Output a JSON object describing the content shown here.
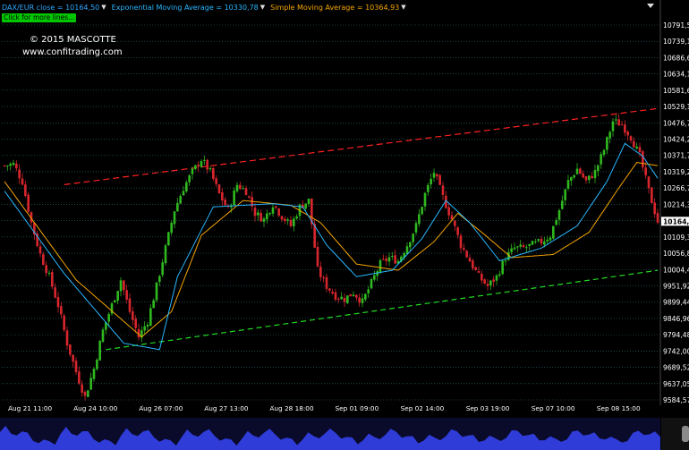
{
  "header": {
    "series": [
      {
        "label": "DAX/EUR close = 10164,50",
        "color": "#2fa8ff"
      },
      {
        "label": "Exponential Moving Average = 10330,78",
        "color": "#29b7ff"
      },
      {
        "label": "Simple Moving Average = 10364,93",
        "color": "#f5a500"
      }
    ],
    "more_lines": "Click for more lines...",
    "copyright": "© 2015 MASCOTTE",
    "website": "www.confitrading.com"
  },
  "colors": {
    "up": "#2fb81f",
    "down": "#d8262e",
    "ema": "#29b7ff",
    "sma": "#f5a500",
    "resistance": "#ff2222",
    "support": "#22dd22",
    "grid": "#2e6f7a",
    "volume": "#2f3cd8",
    "price_tag": "#ffffff"
  },
  "chart_data": {
    "type": "candlestick",
    "y_ticks": [
      "10791,58",
      "10739,10",
      "10686,62",
      "10634,14",
      "10581,66",
      "10529,18",
      "10476,71",
      "10424,23",
      "10371,75",
      "10319,27",
      "10266,79",
      "10214,31",
      "10161,83",
      "10109,35",
      "10056,88",
      "10004,40",
      "9951,92",
      "9899,44",
      "9846,96",
      "9794,48",
      "9742,00",
      "9689,52",
      "9637,05",
      "9584,57"
    ],
    "x_ticks": [
      "Aug 21 11:00",
      "Aug 24 10:00",
      "Aug 26 07:00",
      "Aug 27 13:00",
      "Aug 28 18:00",
      "Sep 01 09:00",
      "Sep 02 14:00",
      "Sep 03 19:00",
      "Sep 07 10:00",
      "Sep 08 15:00"
    ],
    "ylim": [
      9584.57,
      10791.58
    ],
    "last_price": "10164,50",
    "close_path": [
      [
        0,
        10340
      ],
      [
        3,
        10345
      ],
      [
        6,
        10290
      ],
      [
        9,
        10160
      ],
      [
        12,
        10060
      ],
      [
        15,
        9990
      ],
      [
        18,
        9900
      ],
      [
        21,
        9780
      ],
      [
        24,
        9690
      ],
      [
        27,
        9610
      ],
      [
        30,
        9700
      ],
      [
        33,
        9820
      ],
      [
        36,
        9900
      ],
      [
        39,
        9980
      ],
      [
        42,
        9880
      ],
      [
        45,
        9800
      ],
      [
        48,
        9850
      ],
      [
        51,
        9960
      ],
      [
        54,
        10080
      ],
      [
        57,
        10200
      ],
      [
        60,
        10270
      ],
      [
        63,
        10320
      ],
      [
        66,
        10360
      ],
      [
        69,
        10320
      ],
      [
        72,
        10250
      ],
      [
        75,
        10200
      ],
      [
        78,
        10280
      ],
      [
        81,
        10260
      ],
      [
        84,
        10190
      ],
      [
        87,
        10170
      ],
      [
        90,
        10220
      ],
      [
        93,
        10180
      ],
      [
        96,
        10150
      ],
      [
        99,
        10210
      ],
      [
        102,
        10230
      ],
      [
        105,
        10010
      ],
      [
        108,
        9960
      ],
      [
        111,
        9930
      ],
      [
        114,
        9920
      ],
      [
        117,
        9940
      ],
      [
        120,
        9910
      ],
      [
        123,
        9970
      ],
      [
        126,
        10030
      ],
      [
        129,
        10050
      ],
      [
        132,
        10040
      ],
      [
        135,
        10090
      ],
      [
        138,
        10150
      ],
      [
        141,
        10250
      ],
      [
        144,
        10320
      ],
      [
        147,
        10240
      ],
      [
        150,
        10170
      ],
      [
        153,
        10090
      ],
      [
        156,
        10040
      ],
      [
        159,
        9990
      ],
      [
        162,
        9960
      ],
      [
        165,
        9990
      ],
      [
        168,
        10050
      ],
      [
        171,
        10080
      ],
      [
        174,
        10080
      ],
      [
        177,
        10090
      ],
      [
        180,
        10100
      ],
      [
        183,
        10120
      ],
      [
        186,
        10200
      ],
      [
        189,
        10290
      ],
      [
        192,
        10330
      ],
      [
        195,
        10290
      ],
      [
        198,
        10320
      ],
      [
        201,
        10390
      ],
      [
        204,
        10480
      ],
      [
        207,
        10470
      ],
      [
        210,
        10430
      ],
      [
        213,
        10370
      ],
      [
        216,
        10260
      ],
      [
        219,
        10164
      ]
    ],
    "ema_path": [
      [
        0,
        10260
      ],
      [
        20,
        10000
      ],
      [
        40,
        9780
      ],
      [
        52,
        9760
      ],
      [
        58,
        9990
      ],
      [
        70,
        10210
      ],
      [
        90,
        10220
      ],
      [
        100,
        10210
      ],
      [
        108,
        10090
      ],
      [
        118,
        9990
      ],
      [
        130,
        10010
      ],
      [
        140,
        10110
      ],
      [
        148,
        10230
      ],
      [
        156,
        10160
      ],
      [
        166,
        10040
      ],
      [
        180,
        10080
      ],
      [
        192,
        10150
      ],
      [
        202,
        10290
      ],
      [
        208,
        10410
      ],
      [
        214,
        10370
      ],
      [
        219,
        10300
      ]
    ],
    "sma_path": [
      [
        0,
        10290
      ],
      [
        24,
        9980
      ],
      [
        46,
        9800
      ],
      [
        56,
        9880
      ],
      [
        66,
        10120
      ],
      [
        80,
        10230
      ],
      [
        96,
        10215
      ],
      [
        106,
        10160
      ],
      [
        118,
        10030
      ],
      [
        132,
        10010
      ],
      [
        144,
        10100
      ],
      [
        152,
        10190
      ],
      [
        160,
        10130
      ],
      [
        170,
        10050
      ],
      [
        184,
        10060
      ],
      [
        196,
        10130
      ],
      [
        206,
        10270
      ],
      [
        212,
        10350
      ],
      [
        219,
        10340
      ]
    ],
    "resistance": {
      "from": [
        20,
        10280
      ],
      "to": [
        219,
        10520
      ]
    },
    "support": {
      "from": [
        34,
        9760
      ],
      "to": [
        219,
        10010
      ]
    }
  }
}
